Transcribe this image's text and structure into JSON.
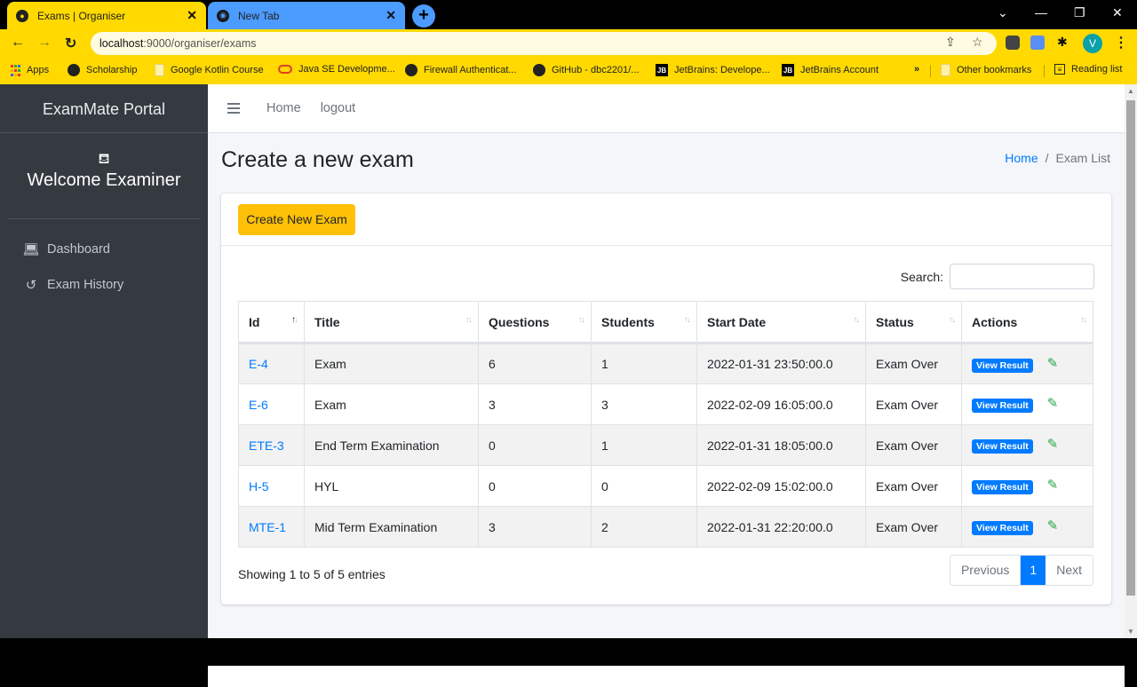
{
  "browser": {
    "tabs": [
      {
        "title": "Exams | Organiser",
        "active": true
      },
      {
        "title": "New Tab",
        "active": false
      }
    ],
    "url": {
      "host": "localhost",
      "rest": ":9000/organiser/exams"
    },
    "profile_initial": "V",
    "bookmarks": [
      {
        "label": "Apps",
        "icon": "apps-grid-icon"
      },
      {
        "label": "Scholarship",
        "icon": "globe-icon"
      },
      {
        "label": "Google Kotlin Course",
        "icon": "folder-icon"
      },
      {
        "label": "Java SE Developme...",
        "icon": "oracle-icon"
      },
      {
        "label": "Firewall Authenticat...",
        "icon": "globe-icon"
      },
      {
        "label": "GitHub - dbc2201/...",
        "icon": "github-icon"
      },
      {
        "label": "JetBrains: Develope...",
        "icon": "jetbrains-icon"
      },
      {
        "label": "JetBrains Account",
        "icon": "jetbrains-icon"
      }
    ],
    "overflow": "»",
    "other_bookmarks": "Other bookmarks",
    "reading_list": "Reading list"
  },
  "sidebar": {
    "brand": "ExamMate Portal",
    "welcome": "Welcome Examiner",
    "items": [
      {
        "label": "Dashboard",
        "icon": "laptop-icon"
      },
      {
        "label": "Exam History",
        "icon": "history-icon"
      }
    ]
  },
  "topnav": {
    "home": "Home",
    "logout": "logout"
  },
  "page": {
    "title": "Create a new exam",
    "breadcrumb": {
      "home": "Home",
      "sep": "/",
      "current": "Exam List"
    },
    "create_button": "Create New Exam",
    "search_label": "Search:",
    "search_value": "",
    "columns": [
      "Id",
      "Title",
      "Questions",
      "Students",
      "Start Date",
      "Status",
      "Actions"
    ],
    "sorted_column": "Id",
    "rows": [
      {
        "id": "E-4",
        "title": "Exam",
        "questions": "6",
        "students": "1",
        "start": "2022-01-31 23:50:00.0",
        "status": "Exam Over"
      },
      {
        "id": "E-6",
        "title": "Exam",
        "questions": "3",
        "students": "3",
        "start": "2022-02-09 16:05:00.0",
        "status": "Exam Over"
      },
      {
        "id": "ETE-3",
        "title": "End Term Examination",
        "questions": "0",
        "students": "1",
        "start": "2022-01-31 18:05:00.0",
        "status": "Exam Over"
      },
      {
        "id": "H-5",
        "title": "HYL",
        "questions": "0",
        "students": "0",
        "start": "2022-02-09 15:02:00.0",
        "status": "Exam Over"
      },
      {
        "id": "MTE-1",
        "title": "Mid Term Examination",
        "questions": "3",
        "students": "2",
        "start": "2022-01-31 22:20:00.0",
        "status": "Exam Over"
      }
    ],
    "view_result_label": "View Result",
    "info": "Showing 1 to 5 of 5 entries",
    "pager": {
      "previous": "Previous",
      "current": "1",
      "next": "Next"
    }
  },
  "colors": {
    "accent": "#007bff",
    "create_button": "#ffc107",
    "edit_icon": "#28a745",
    "sidebar": "#343a40",
    "browser_theme": "#ffd900"
  }
}
